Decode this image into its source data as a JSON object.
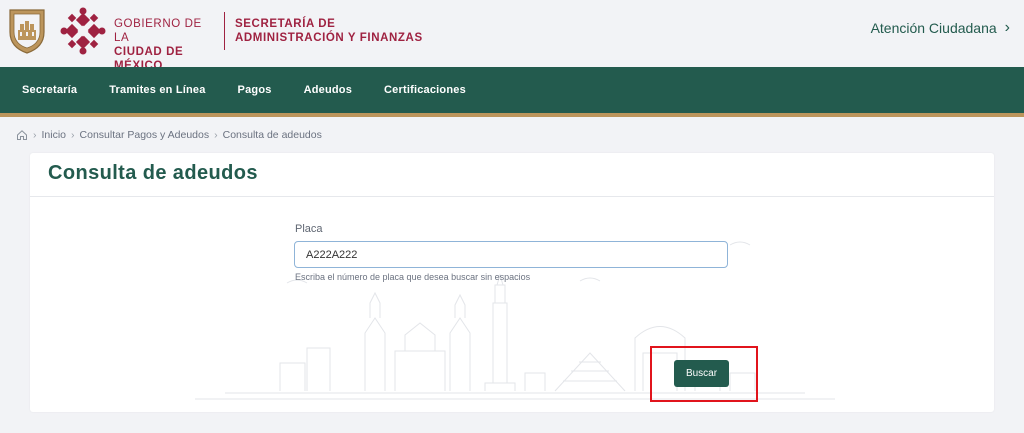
{
  "header": {
    "gov_line1": "GOBIERNO DE LA",
    "gov_line2": "CIUDAD DE MÉXICO",
    "sec_line1": "SECRETARÍA DE",
    "sec_line2": "ADMINISTRACIÓN Y FINANZAS",
    "atencion_label": "Atención Ciudadana",
    "atencion_chevron": "›"
  },
  "nav": {
    "items": [
      {
        "label": "Secretaría"
      },
      {
        "label": "Tramites en Línea"
      },
      {
        "label": "Pagos"
      },
      {
        "label": "Adeudos"
      },
      {
        "label": "Certificaciones"
      }
    ]
  },
  "breadcrumb": {
    "items": [
      "Inicio",
      "Consultar Pagos y Adeudos",
      "Consulta de adeudos"
    ],
    "separator": "›"
  },
  "card": {
    "title": "Consulta de adeudos"
  },
  "form": {
    "label": "Placa",
    "value": "A222A222",
    "help": "Escriba el número de placa que desea buscar sin espacios",
    "submit_label": "Buscar"
  },
  "colors": {
    "brand_green": "#235b4e",
    "brand_wine": "#9f2241",
    "brand_gold": "#bc955c",
    "highlight_red": "#e1141c"
  },
  "icons": [
    "city-shield-icon",
    "gov-logo-icon",
    "chevron-right-icon",
    "home-icon",
    "skyline-illustration"
  ]
}
